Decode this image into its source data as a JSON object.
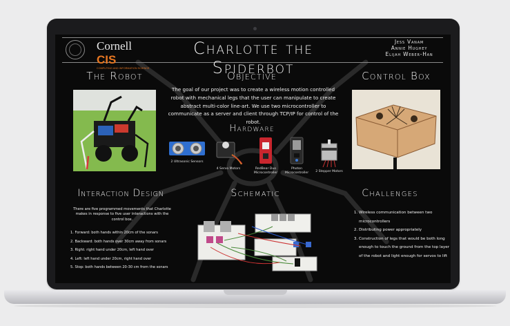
{
  "poster": {
    "logo_word": "Cornell",
    "logo_cis": "CIS",
    "logo_sub": "COMPUTING AND INFORMATION SCIENCE",
    "title": "Charlotte the Spiderbot",
    "authors": [
      "Jess Vanam",
      "Annie Hughey",
      "Elijah Weber-Han"
    ]
  },
  "robot": {
    "heading": "The Robot"
  },
  "objective": {
    "heading": "Objective",
    "text": "The goal of our project was to create a wireless motion controlled robot with mechanical legs that the user can manipulate to create abstract multi-color line-art. We use two microcontroller to communicate as a server and client through TCP/IP for control of the robot."
  },
  "control_box": {
    "heading": "Control Box"
  },
  "hardware": {
    "heading": "Hardware",
    "items": [
      {
        "label": "2 Ultrasonic Sensors",
        "icon": "ultrasonic-sensor-icon"
      },
      {
        "label": "4 Servo Motors",
        "icon": "servo-motor-icon"
      },
      {
        "label": "RedBear Duo Microcontroller",
        "icon": "redbear-duo-icon"
      },
      {
        "label": "Photon Microcontroller",
        "icon": "photon-icon"
      },
      {
        "label": "2 Stepper Motors",
        "icon": "stepper-motor-icon"
      }
    ]
  },
  "interaction": {
    "heading": "Interaction Design",
    "intro": "There are five programmed movements that Charlotte makes in response to five user interactions with the control box.",
    "items": [
      "1. Forward: both hands within 20cm of the sonars",
      "2. Backward: both hands over 30cm away from sonars",
      "3. Right: right hand under 20cm, left hand over",
      "4. Left: left hand under 20cm, right hand over",
      "5. Stop: both hands between 20-30 cm from the sonars"
    ]
  },
  "schematic": {
    "heading": "Schematic"
  },
  "challenges": {
    "heading": "Challenges",
    "items": [
      "Wireless communication between two microcontrollers",
      "Distributing power appropriately",
      "Construction of legs that would be both long enough to touch the ground from the top layer of the robot and light enough for servos to lift"
    ]
  },
  "colors": {
    "background": "#0a0a0a",
    "text": "#f3f3f3",
    "cornell_orange": "#e87722",
    "robot_bg": "#7fb54b"
  }
}
